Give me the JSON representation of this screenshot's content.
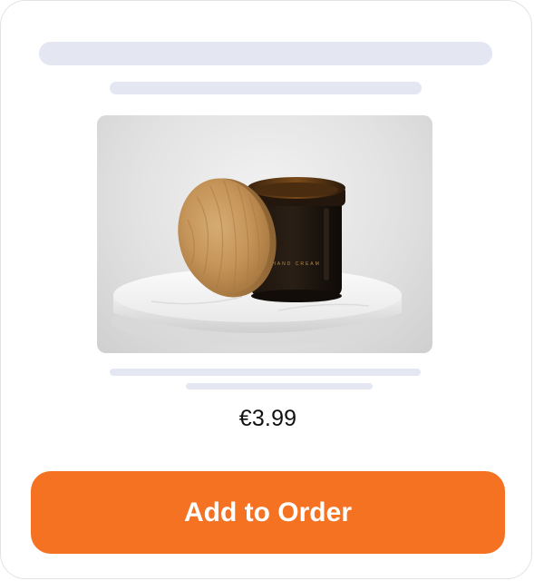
{
  "product": {
    "price": "€3.99",
    "image_subject": "amber glass jar with wooden lid on marble pedestal",
    "jar_label": "HAND CREAM"
  },
  "actions": {
    "add_label": "Add to Order"
  },
  "colors": {
    "accent": "#f47222",
    "skeleton": "#e4e6f1",
    "card_border": "#e3e3e6"
  }
}
